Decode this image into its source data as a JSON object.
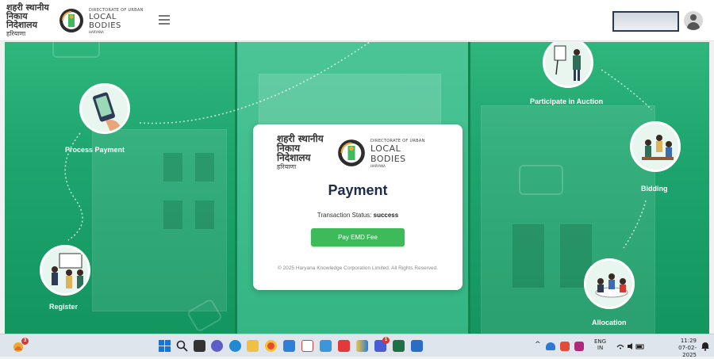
{
  "header": {
    "brand_hindi_line1": "शहरी स्थानीय",
    "brand_hindi_line2": "निकाय निदेशालय",
    "brand_hindi_sub": "हरियाणा",
    "brand_en_top": "DIRECTORATE OF URBAN",
    "brand_en_main": "LOCAL BODIES",
    "brand_en_sub": "HARYANA"
  },
  "steps": {
    "process_payment": "Process Payment",
    "participate": "Participate in Auction",
    "bidding": "Bidding",
    "register": "Register",
    "allocation": "Allocation"
  },
  "card": {
    "brand_hindi_line1": "शहरी स्थानीय",
    "brand_hindi_line2": "निकाय निदेशालय",
    "brand_hindi_sub": "हरियाणा",
    "brand_en_top": "DIRECTORATE OF URBAN",
    "brand_en_main": "LOCAL BODIES",
    "brand_en_sub": "HARYANA",
    "title": "Payment",
    "status_label": "Transaction Status:",
    "status_value": "success",
    "button_label": "Pay EMD Fee",
    "footer": "© 2025 Haryana Knowledge Corporation Limited. All Rights Reserved."
  },
  "taskbar": {
    "notification_count": "3",
    "store_badge": "1",
    "teams_badge": "1",
    "lang_line1": "ENG",
    "lang_line2": "IN",
    "time": "11:29",
    "date": "07-02-2025"
  },
  "colors": {
    "hero_green": "#1ea56e",
    "button_green": "#3dbb5b",
    "title_navy": "#1d2b4c"
  }
}
